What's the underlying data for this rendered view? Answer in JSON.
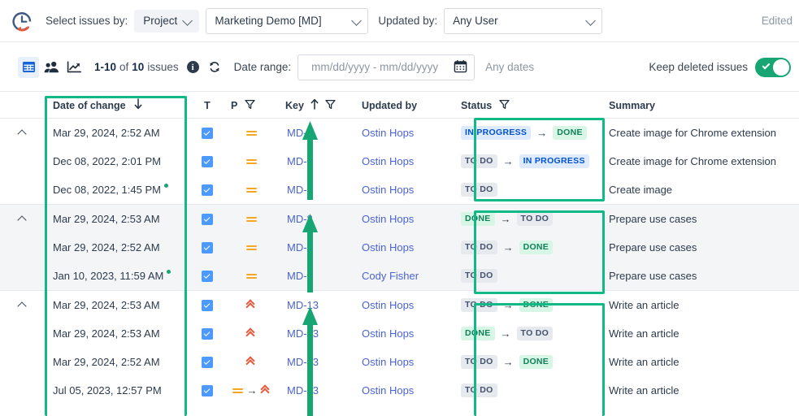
{
  "brand": {
    "logo_icon": "clock-history-icon"
  },
  "filters": {
    "select_issues_label": "Select issues by:",
    "issue_source": "Project",
    "project": "Marketing Demo [MD]",
    "updated_by_label": "Updated by:",
    "updated_by": "Any User",
    "edited": "Edited"
  },
  "toolbar": {
    "view_table_icon": "table-view-icon",
    "view_people_icon": "people-view-icon",
    "view_chart_icon": "chart-view-icon",
    "count_prefix": "1-10",
    "count_mid": "of",
    "count_total": "10",
    "count_suffix": "issues",
    "info_icon": "info-icon",
    "refresh_icon": "refresh-icon",
    "date_range_label": "Date range:",
    "date_placeholder": "mm/dd/yyyy - mm/dd/yyyy",
    "calendar_icon": "calendar-icon",
    "any_dates": "Any dates",
    "keep_deleted_label": "Keep deleted issues",
    "keep_deleted_on": true
  },
  "table": {
    "headers": {
      "date": "Date of change",
      "sort_icon": "sort-desc-arrow-icon",
      "t": "T",
      "p": "P",
      "p_filter_icon": "filter-icon",
      "key": "Key",
      "key_sort_icon": "sort-asc-arrow-icon",
      "key_filter_icon": "filter-icon",
      "updated_by": "Updated by",
      "status": "Status",
      "status_filter_icon": "filter-icon",
      "summary": "Summary"
    },
    "groups": [
      {
        "shaded": false,
        "rows": [
          {
            "date": "Mar 29, 2024, 2:52 AM",
            "dot": false,
            "checked": true,
            "prio": "med",
            "prio_to": null,
            "key": "MD-7",
            "updated_by": "Ostin Hops",
            "status_from": "IN PROGRESS",
            "status_from_kind": "prog",
            "status_to": "DONE",
            "status_to_kind": "done",
            "summary": "Create image for Chrome extension"
          },
          {
            "date": "Dec 08, 2022, 2:01 PM",
            "dot": false,
            "checked": true,
            "prio": "med",
            "prio_to": null,
            "key": "MD-7",
            "updated_by": "Ostin Hops",
            "status_from": "TO DO",
            "status_from_kind": "todo",
            "status_to": "IN PROGRESS",
            "status_to_kind": "prog",
            "summary": "Create image for Chrome extension"
          },
          {
            "date": "Dec 08, 2022, 1:45 PM",
            "dot": true,
            "checked": true,
            "prio": "med",
            "prio_to": null,
            "key": "MD-7",
            "updated_by": "Ostin Hops",
            "status_from": "TO DO",
            "status_from_kind": "todo",
            "status_to": null,
            "status_to_kind": null,
            "summary": "Create image"
          }
        ]
      },
      {
        "shaded": true,
        "rows": [
          {
            "date": "Mar 29, 2024, 2:53 AM",
            "dot": false,
            "checked": true,
            "prio": "med",
            "prio_to": null,
            "key": "MD-8",
            "updated_by": "Ostin Hops",
            "status_from": "DONE",
            "status_from_kind": "done",
            "status_to": "TO DO",
            "status_to_kind": "todo",
            "summary": "Prepare use cases"
          },
          {
            "date": "Mar 29, 2024, 2:52 AM",
            "dot": false,
            "checked": true,
            "prio": "med",
            "prio_to": null,
            "key": "MD-8",
            "updated_by": "Ostin Hops",
            "status_from": "TO DO",
            "status_from_kind": "todo",
            "status_to": "DONE",
            "status_to_kind": "done",
            "summary": "Prepare use cases"
          },
          {
            "date": "Jan 10, 2023, 11:59 AM",
            "dot": true,
            "checked": true,
            "prio": "med",
            "prio_to": null,
            "key": "MD-8",
            "updated_by": "Cody Fisher",
            "status_from": "TO DO",
            "status_from_kind": "todo",
            "status_to": null,
            "status_to_kind": null,
            "summary": "Prepare use cases"
          }
        ]
      },
      {
        "shaded": false,
        "rows": [
          {
            "date": "Mar 29, 2024, 2:53 AM",
            "dot": false,
            "checked": true,
            "prio": "high",
            "prio_to": null,
            "key": "MD-13",
            "updated_by": "Ostin Hops",
            "status_from": "TO DO",
            "status_from_kind": "todo",
            "status_to": "DONE",
            "status_to_kind": "done",
            "summary": "Write an article"
          },
          {
            "date": "Mar 29, 2024, 2:53 AM",
            "dot": false,
            "checked": true,
            "prio": "high",
            "prio_to": null,
            "key": "MD-13",
            "updated_by": "Ostin Hops",
            "status_from": "DONE",
            "status_from_kind": "done",
            "status_to": "TO DO",
            "status_to_kind": "todo",
            "summary": "Write an article"
          },
          {
            "date": "Mar 29, 2024, 2:52 AM",
            "dot": false,
            "checked": true,
            "prio": "high",
            "prio_to": null,
            "key": "MD-13",
            "updated_by": "Ostin Hops",
            "status_from": "TO DO",
            "status_from_kind": "todo",
            "status_to": "DONE",
            "status_to_kind": "done",
            "summary": "Write an article"
          },
          {
            "date": "Jul 05, 2023, 12:57 PM",
            "dot": false,
            "checked": true,
            "prio": "med",
            "prio_to": "high",
            "key": "MD-13",
            "updated_by": "Ostin Hops",
            "status_from": "TO DO",
            "status_from_kind": "todo",
            "status_to": null,
            "status_to_kind": null,
            "summary": "Write an article"
          }
        ]
      }
    ]
  },
  "annotations": {
    "highlight_color": "#12b886",
    "date_column_box": "date-of-change-column-highlight",
    "status_column_box": "status-column-highlight",
    "key_column_arrows": "key-column-up-arrow"
  }
}
